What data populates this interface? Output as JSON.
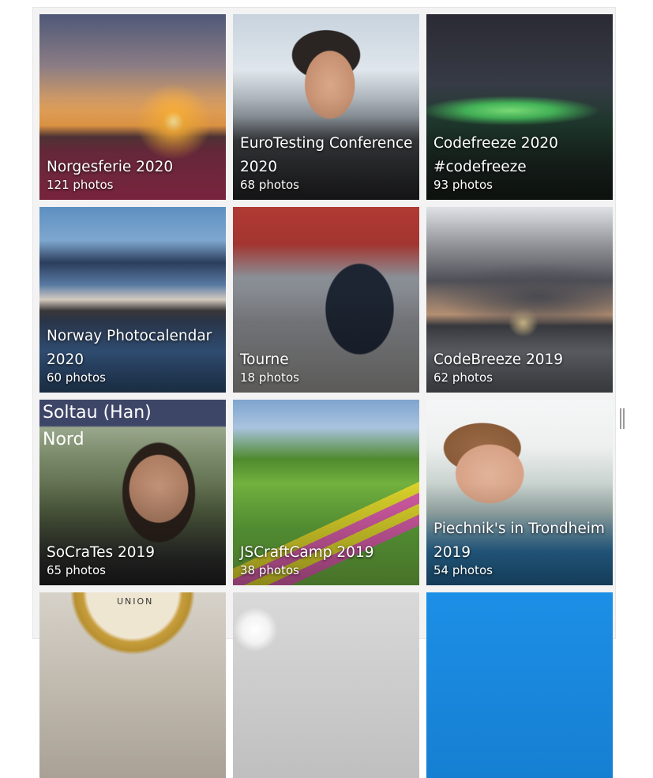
{
  "albums": [
    {
      "title": "Norgesferie 2020",
      "count": "121 photos",
      "photo_icon": "sunset-photo"
    },
    {
      "title": "EuroTesting Conference 2020",
      "count": "68 photos",
      "photo_icon": "airport-selfie-photo"
    },
    {
      "title": "Codefreeze 2020 #codefreeze",
      "count": "93 photos",
      "photo_icon": "aurora-photo"
    },
    {
      "title": "Norway Photocalendar 2020",
      "count": "60 photos",
      "photo_icon": "city-bridge-photo"
    },
    {
      "title": "Tourne",
      "count": "18 photos",
      "photo_icon": "van-photo"
    },
    {
      "title": "CodeBreeze 2019",
      "count": "62 photos",
      "photo_icon": "cloud-sunset-photo"
    },
    {
      "title": "SoCraTes 2019",
      "count": "65 photos",
      "photo_icon": "station-selfie-photo"
    },
    {
      "title": "JSCraftCamp 2019",
      "count": "38 photos",
      "photo_icon": "park-bench-photo"
    },
    {
      "title": "Piechnik's in Trondheim 2019",
      "count": "54 photos",
      "photo_icon": "child-photo"
    }
  ],
  "partial_row": {
    "union_sign": "UNION",
    "photos": [
      "union-clock-photo",
      "ceiling-photo",
      "blue-photo"
    ]
  },
  "sign_text": "Soltau (Han) Nord"
}
